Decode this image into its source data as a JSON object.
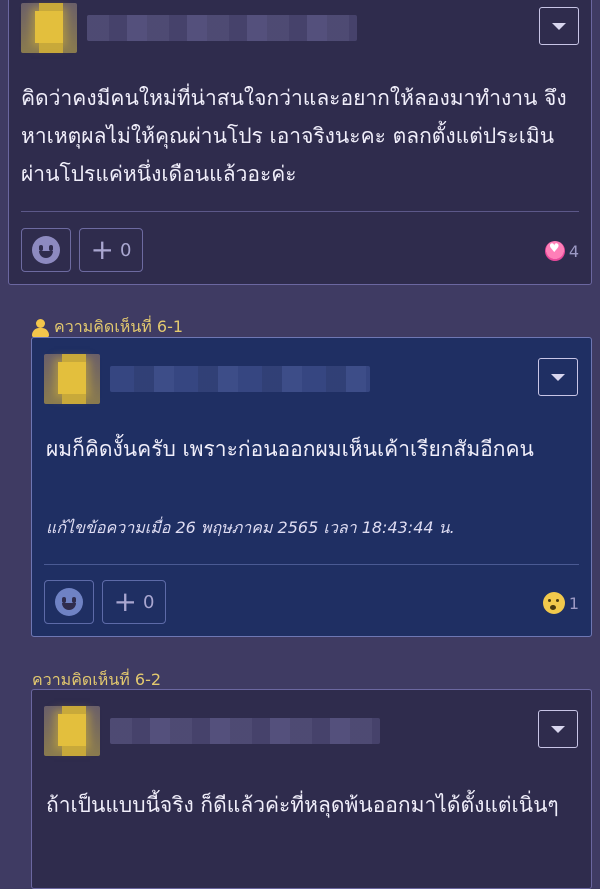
{
  "comment_main": {
    "text": "คิดว่าคงมีคนใหม่ที่น่าสนใจกว่าและอยากให้ลองมาทำงาน จึงหาเหตุผลไม่ให้คุณผ่านโปร เอาจริงนะคะ ตลกตั้งแต่ประเมินผ่านโปรแค่หนึ่งเดือนแล้วอะค่ะ",
    "plus_count": "0",
    "reaction_icon": "heart-face-icon",
    "reaction_count": "4"
  },
  "reply_1": {
    "label": "ความคิดเห็นที่ 6-1",
    "text": "ผมก็คิดงั้นครับ เพราะก่อนออกผมเห็นเค้าเรียกสัมอีกคน",
    "edit_note": "แก้ไขข้อความเมื่อ 26 พฤษภาคม 2565 เวลา 18:43:44 น.",
    "plus_count": "0",
    "reaction_icon": "drool-face-icon",
    "reaction_count": "1"
  },
  "reply_2": {
    "label": "ความคิดเห็นที่ 6-2",
    "text": "ถ้าเป็นแบบนี้จริง ก็ดีแล้วค่ะที่หลุดพ้นออกมาได้ตั้งแต่เนิ่นๆ"
  },
  "colors": {
    "page_bg": "#3f3b63",
    "card_bg": "#2f2c4d",
    "highlight_card_bg": "#1f2f63",
    "label_color": "#e3c96f"
  }
}
